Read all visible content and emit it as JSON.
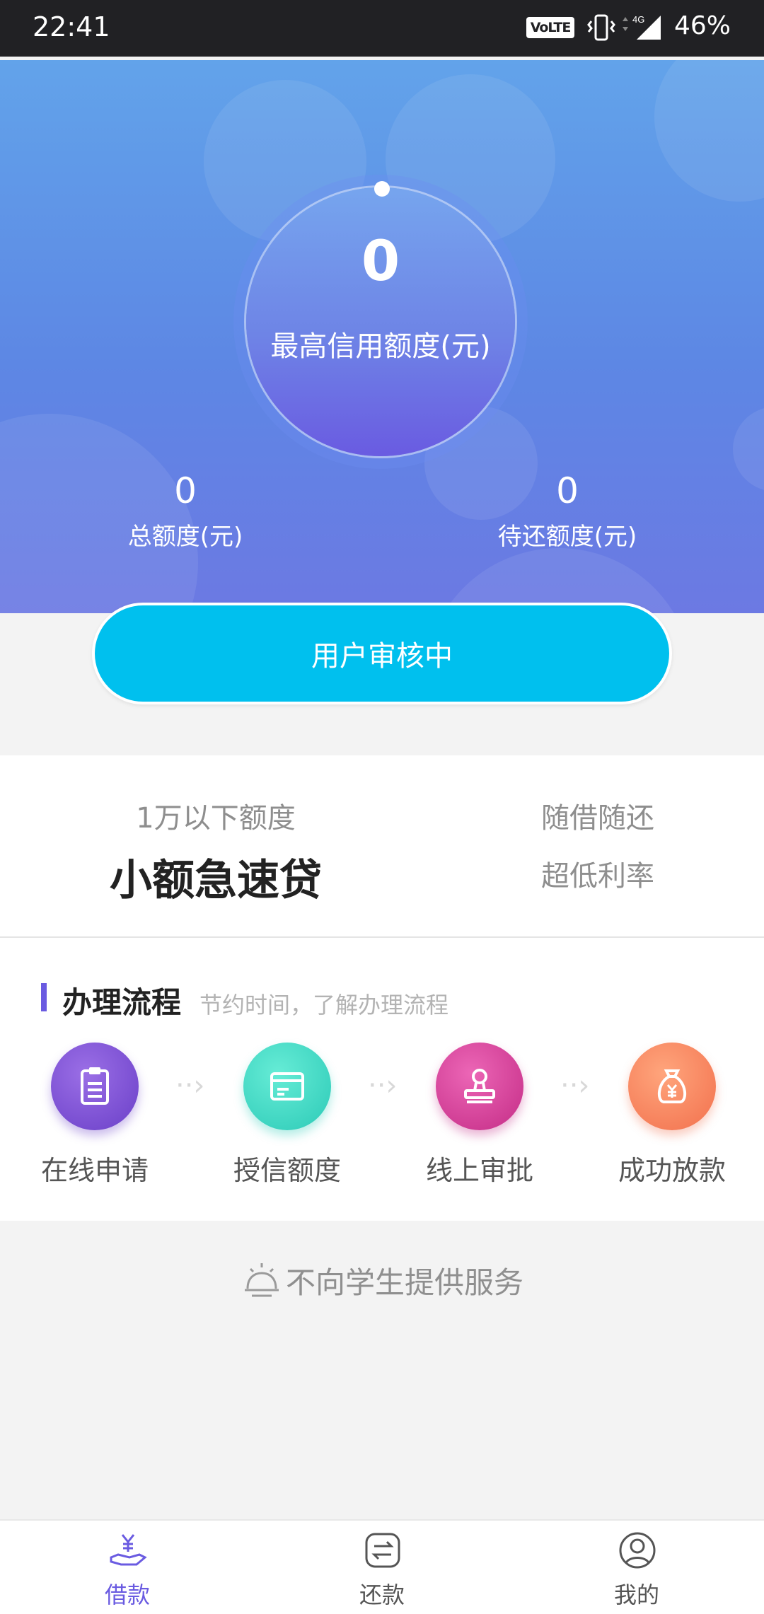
{
  "status_bar": {
    "time": "22:41",
    "volte": "VoLTE",
    "network": "4G",
    "battery": "46%"
  },
  "hero": {
    "credit_value": "0",
    "credit_label": "最高信用额度(元)",
    "total_value": "0",
    "total_label": "总额度(元)",
    "pending_value": "0",
    "pending_label": "待还额度(元)"
  },
  "status_button": {
    "label": "用户审核中"
  },
  "product": {
    "limit": "1万以下额度",
    "title": "小额急速贷",
    "feature_1": "随借随还",
    "feature_2": "超低利率"
  },
  "process": {
    "title": "办理流程",
    "subtitle": "节约时间，了解办理流程",
    "steps": [
      {
        "label": "在线申请",
        "icon": "clipboard-icon"
      },
      {
        "label": "授信额度",
        "icon": "card-icon"
      },
      {
        "label": "线上审批",
        "icon": "stamp-icon"
      },
      {
        "label": "成功放款",
        "icon": "money-bag-icon"
      }
    ]
  },
  "notice": {
    "text": "不向学生提供服务",
    "icon": "bell-icon"
  },
  "tab_bar": {
    "tabs": [
      {
        "label": "借款",
        "icon": "loan-hand-icon",
        "active": true
      },
      {
        "label": "还款",
        "icon": "repay-icon",
        "active": false
      },
      {
        "label": "我的",
        "icon": "user-icon",
        "active": false
      }
    ]
  },
  "colors": {
    "accent": "#6a5be1",
    "button": "#00c0ee",
    "step_1": "#7a55d6",
    "step_2": "#3fd8c4",
    "step_3": "#d23f97",
    "step_4": "#f77c5b"
  }
}
